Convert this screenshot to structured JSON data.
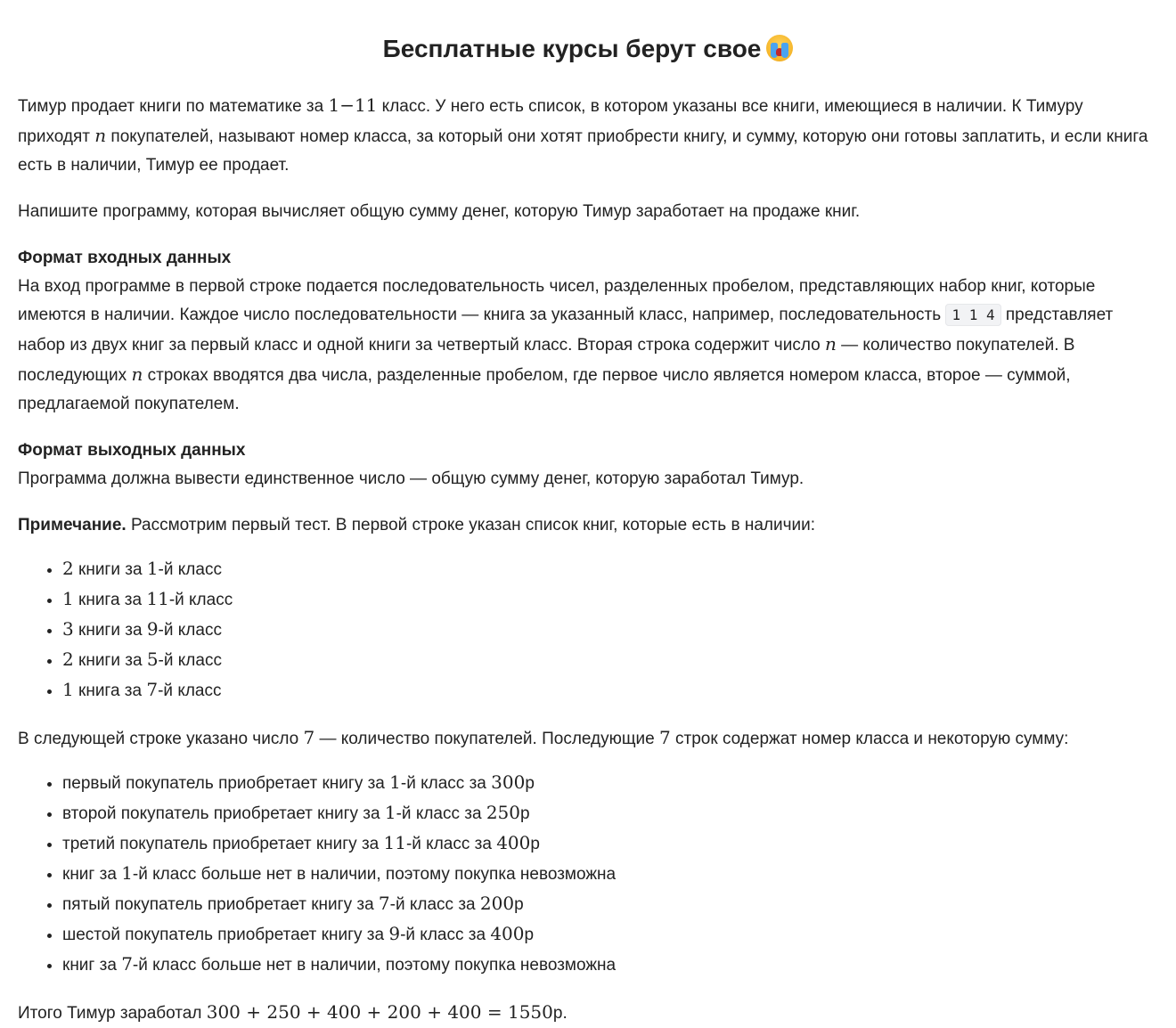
{
  "title": "Бесплатные курсы берут свое",
  "title_emoji": "loudly-crying-face",
  "intro": {
    "t1": "Тимур продает книги по математике за ",
    "m1": "1−11",
    "t2": " класс. У него есть список, в котором указаны все книги, имеющиеся в наличии. К Тимуру приходят ",
    "m2": "n",
    "t3": " покупателей, называют номер класса, за который они хотят приобрести книгу, и сумму, которую они готовы заплатить, и если книга есть в наличии, Тимур ее продает."
  },
  "task": "Напишите программу, которая вычисляет общую сумму денег, которую Тимур заработает на продаже книг.",
  "input": {
    "heading": "Формат входных данных",
    "t1": "На вход программе в первой строке подается последовательность чисел, разделенных пробелом, представляющих набор книг, которые имеются в наличии. Каждое число последовательности — книга за указанный класс, например, последовательность ",
    "code": "1 1 4",
    "t2": " представляет набор из двух книг за первый класс и одной книги за четвертый класс. Вторая строка содержит число ",
    "m1": "n",
    "t3": " — количество покупателей. В последующих ",
    "m2": "n",
    "t4": " строках вводятся два числа, разделенные пробелом, где первое число является номером класса, второе — суммой, предлагаемой покупателем."
  },
  "output": {
    "heading": "Формат выходных данных",
    "text": "Программа должна вывести единственное число — общую сумму денег, которую заработал Тимур."
  },
  "note": {
    "label": "Примечание.",
    "text": " Рассмотрим первый тест. В первой строке указан список книг, которые есть в наличии:"
  },
  "books": [
    {
      "n": "2",
      "text": " книги за ",
      "g": "1",
      "tail": "-й класс"
    },
    {
      "n": "1",
      "text": " книга за ",
      "g": "11",
      "tail": "-й класс"
    },
    {
      "n": "3",
      "text": " книги за ",
      "g": "9",
      "tail": "-й класс"
    },
    {
      "n": "2",
      "text": " книги за ",
      "g": "5",
      "tail": "-й класс"
    },
    {
      "n": "1",
      "text": " книга за ",
      "g": "7",
      "tail": "-й класс"
    }
  ],
  "next": {
    "t1": "В следующей строке указано число ",
    "m1": "7",
    "t2": " — количество покупателей. Последующие ",
    "m2": "7",
    "t3": " строк содержат номер класса и некоторую сумму:"
  },
  "buyers": [
    {
      "a": "первый покупатель приобретает книгу за ",
      "g": "1",
      "b": "-й класс за ",
      "sum": "300",
      "c": "р"
    },
    {
      "a": "второй покупатель приобретает книгу за ",
      "g": "1",
      "b": "-й класс за ",
      "sum": "250",
      "c": "р"
    },
    {
      "a": "третий покупатель приобретает книгу за ",
      "g": "11",
      "b": "-й класс за ",
      "sum": "400",
      "c": "р"
    },
    {
      "a": "книг за ",
      "g": "1",
      "b": "-й класс больше нет в наличии, поэтому покупка невозможна",
      "sum": "",
      "c": ""
    },
    {
      "a": "пятый покупатель приобретает книгу за ",
      "g": "7",
      "b": "-й класс за ",
      "sum": "200",
      "c": "р"
    },
    {
      "a": "шестой покупатель приобретает книгу за ",
      "g": "9",
      "b": "-й класс за ",
      "sum": "400",
      "c": "р"
    },
    {
      "a": "книг за ",
      "g": "7",
      "b": "-й класс больше нет в наличии, поэтому покупка невозможна",
      "sum": "",
      "c": ""
    }
  ],
  "total": {
    "t1": "Итого Тимур заработал ",
    "m1": "300 + 250 + 400 + 200 + 400 = 1550",
    "t2": "р."
  }
}
